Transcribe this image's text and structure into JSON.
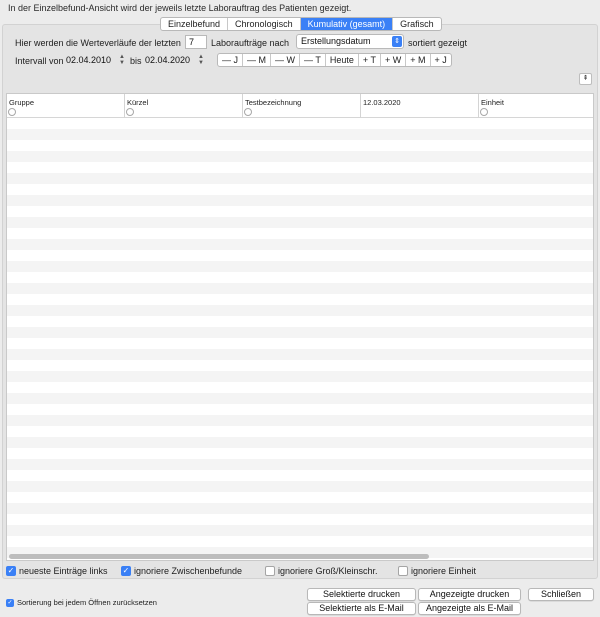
{
  "info_text": "In der Einzelbefund-Ansicht wird der jeweils letzte Laborauftrag des Patienten gezeigt.",
  "tabs": [
    {
      "label": "Einzelbefund",
      "active": false
    },
    {
      "label": "Chronologisch",
      "active": false
    },
    {
      "label": "Kumulativ (gesamt)",
      "active": true
    },
    {
      "label": "Grafisch",
      "active": false
    }
  ],
  "filter": {
    "prefix": "Hier werden die Werteverläufe der letzten",
    "count": "7",
    "middle": "Laboraufträge nach",
    "sort_field": "Erstellungsdatum",
    "suffix": "sortiert gezeigt"
  },
  "interval": {
    "label": "Intervall von",
    "from": "02.04.2010",
    "to_label": "bis",
    "to": "02.04.2020"
  },
  "date_buttons": [
    "— J",
    "— M",
    "— W",
    "— T",
    "Heute",
    "+ T",
    "+ W",
    "+ M",
    "+ J"
  ],
  "table": {
    "columns": [
      "Gruppe",
      "Kürzel",
      "Testbezeichnung",
      "12.03.2020",
      "Einheit"
    ],
    "row_count": 40
  },
  "options": {
    "newest_left": {
      "label": "neueste Einträge links",
      "checked": true
    },
    "ignore_intermediate": {
      "label": "ignoriere Zwischenbefunde",
      "checked": true
    },
    "ignore_case": {
      "label": "ignoriere Groß/Kleinschr.",
      "checked": false
    },
    "ignore_unit": {
      "label": "ignoriere Einheit",
      "checked": false
    },
    "reset_sort": {
      "label": "Sortierung bei jedem Öffnen zurücksetzen",
      "checked": true
    }
  },
  "buttons": {
    "print_selected": "Selektierte drucken",
    "print_shown": "Angezeigte drucken",
    "close": "Schließen",
    "email_selected": "Selektierte als E-Mail",
    "email_shown": "Angezeigte als E-Mail"
  },
  "colors": {
    "accent": "#3a80f6",
    "zebra": "#f4f4f4"
  }
}
